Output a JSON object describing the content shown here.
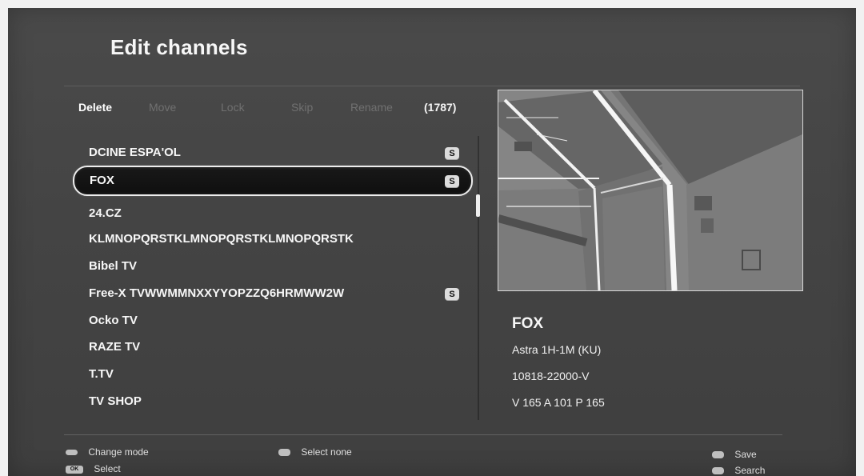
{
  "page": {
    "title": "Edit channels"
  },
  "modes": {
    "items": [
      {
        "label": "Delete",
        "active": true
      },
      {
        "label": "Move",
        "active": false
      },
      {
        "label": "Lock",
        "active": false
      },
      {
        "label": "Skip",
        "active": false
      },
      {
        "label": "Rename",
        "active": false
      }
    ],
    "count": "(1787)"
  },
  "channels": [
    {
      "name": "DCINE ESPA'OL",
      "scrambled": true,
      "selected": false,
      "icon_label": "S"
    },
    {
      "name": "FOX",
      "scrambled": true,
      "selected": true,
      "icon_label": "S"
    },
    {
      "name": "24.CZ",
      "scrambled": false,
      "selected": false
    },
    {
      "name": "KLMNOPQRSTKLMNOPQRSTKLMNOPQRSTK",
      "scrambled": false,
      "selected": false
    },
    {
      "name": "Bibel TV",
      "scrambled": false,
      "selected": false
    },
    {
      "name": "Free-X TVWWMMNXXYYOPZZQ6HRMWW2W",
      "scrambled": true,
      "selected": false,
      "icon_label": "S"
    },
    {
      "name": "Ocko TV",
      "scrambled": false,
      "selected": false
    },
    {
      "name": "RAZE TV",
      "scrambled": false,
      "selected": false
    },
    {
      "name": "T.TV",
      "scrambled": false,
      "selected": false
    },
    {
      "name": "TV SHOP",
      "scrambled": false,
      "selected": false
    }
  ],
  "info": {
    "channel_name": "FOX",
    "satellite": "Astra 1H-1M (KU)",
    "transponder": "10818-22000-V",
    "pids": "V 165 A 101 P 165"
  },
  "footer": {
    "change_mode_label": "Change mode",
    "ok_label": "OK",
    "select_label": "Select",
    "select_none_label": "Select none",
    "save_label": "Save",
    "search_label": "Search"
  },
  "icons": {
    "scrambled": "scrambled-icon",
    "remote_ok": "ok-key-icon",
    "legend_key": "button-key-icon"
  }
}
